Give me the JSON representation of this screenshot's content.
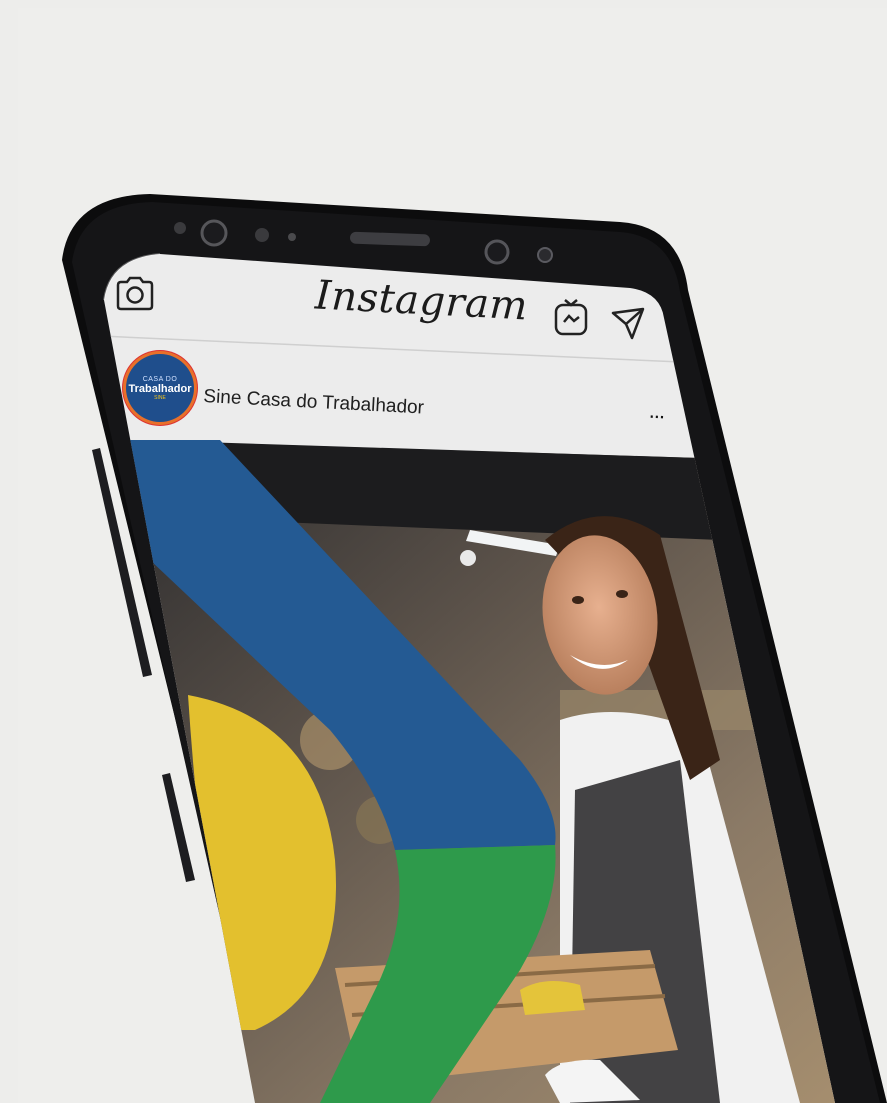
{
  "app": {
    "title": "Instagram"
  },
  "post": {
    "username": "Sine Casa do Trabalhador",
    "more_label": "...",
    "avatar": {
      "line1": "CASA DO",
      "line2": "Trabalhador",
      "line3": "SINE"
    }
  },
  "icons": {
    "camera": "camera-icon",
    "igtv": "igtv-icon",
    "direct": "direct-message-icon",
    "more": "more-options-icon"
  },
  "colors": {
    "background": "#eeeeec",
    "phone": "#0d0d0e",
    "header_bg": "#ececec",
    "brand_blue": "#245a93",
    "brand_yellow": "#e3c02e",
    "brand_green": "#2e9a4b"
  }
}
